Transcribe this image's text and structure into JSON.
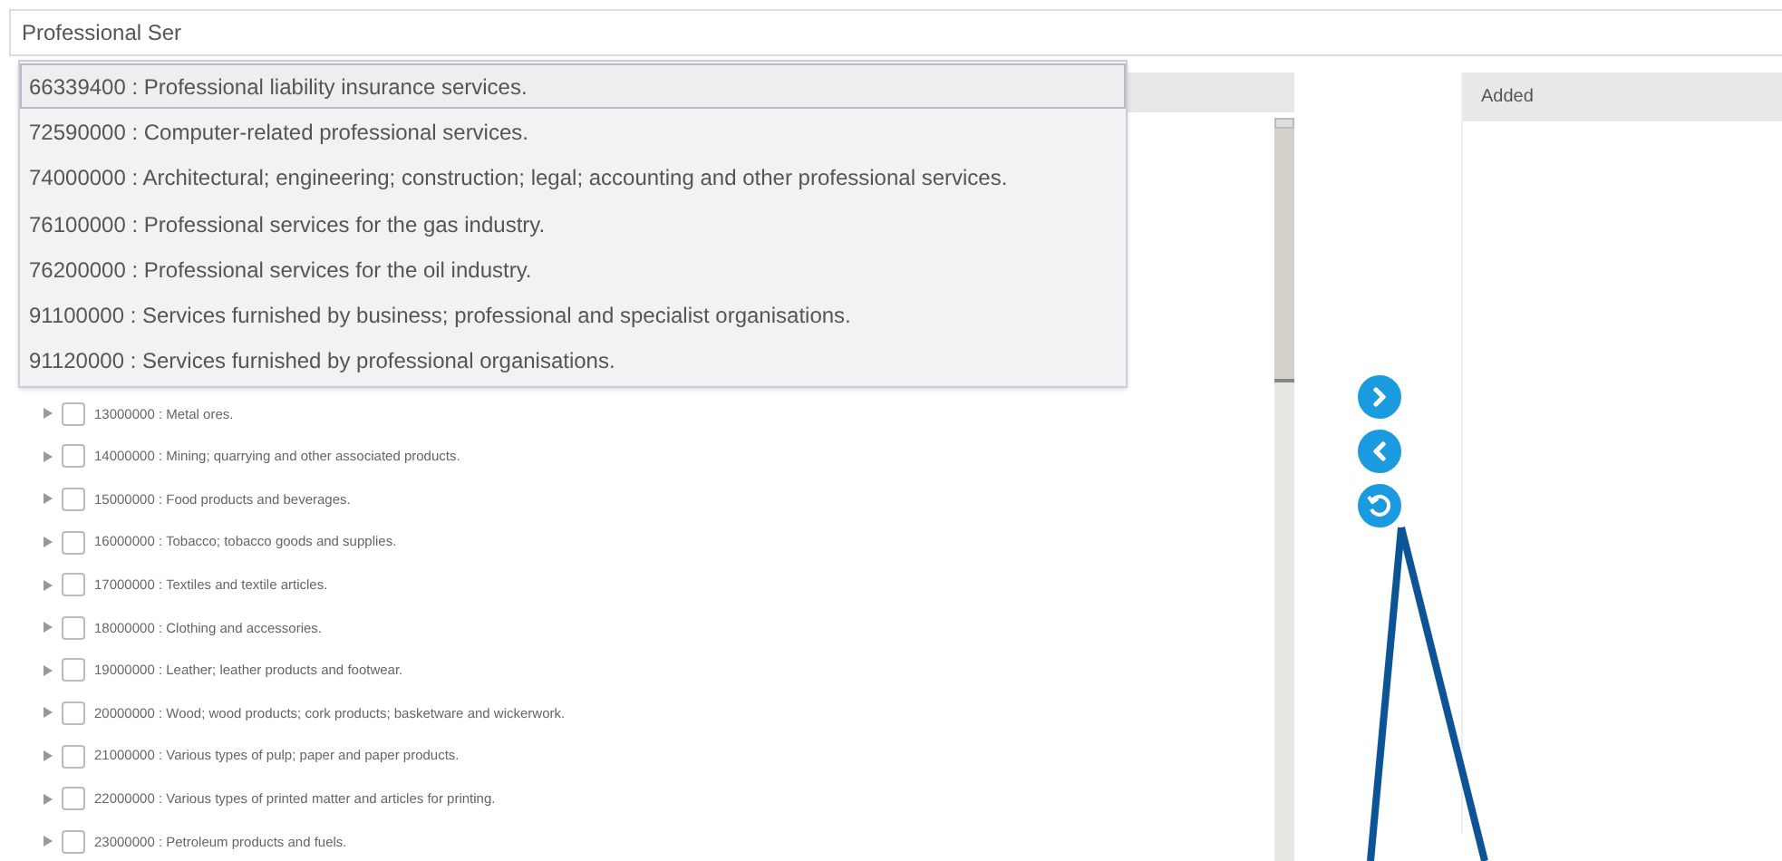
{
  "search": {
    "value": "Professional Ser"
  },
  "suggestions": [
    {
      "label": "66339400 : Professional liability insurance services.",
      "selected": true
    },
    {
      "label": "72590000 : Computer-related professional services.",
      "selected": false
    },
    {
      "label": "74000000 : Architectural; engineering; construction; legal; accounting and other professional services.",
      "selected": false
    },
    {
      "label": "76100000 : Professional services for the gas industry.",
      "selected": false
    },
    {
      "label": "76200000 : Professional services for the oil industry.",
      "selected": false
    },
    {
      "label": "91100000 : Services furnished by business; professional and specialist organisations.",
      "selected": false
    },
    {
      "label": "91120000 : Services furnished by professional organisations.",
      "selected": false
    }
  ],
  "tree": [
    {
      "label": "13000000 : Metal ores.",
      "checked": false
    },
    {
      "label": "14000000 : Mining; quarrying and other associated products.",
      "checked": false
    },
    {
      "label": "15000000 : Food products and beverages.",
      "checked": false
    },
    {
      "label": "16000000 : Tobacco; tobacco goods and supplies.",
      "checked": false
    },
    {
      "label": "17000000 : Textiles and textile articles.",
      "checked": false
    },
    {
      "label": "18000000 : Clothing and accessories.",
      "checked": false
    },
    {
      "label": "19000000 : Leather; leather products and footwear.",
      "checked": false
    },
    {
      "label": "20000000 : Wood; wood products; cork products; basketware and wickerwork.",
      "checked": false
    },
    {
      "label": "21000000 : Various types of pulp; paper and paper products.",
      "checked": false
    },
    {
      "label": "22000000 : Various types of printed matter and articles for printing.",
      "checked": false
    },
    {
      "label": "23000000 : Petroleum products and fuels.",
      "checked": false
    }
  ],
  "added_panel": {
    "title": "Added"
  }
}
